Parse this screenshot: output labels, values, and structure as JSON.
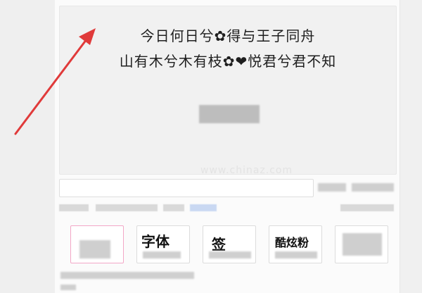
{
  "preview": {
    "line1": "今日何日兮✿得与王子同舟",
    "line2": "山有木兮木有枝✿❤悦君兮君不知",
    "watermark": "www.chinaz.com"
  },
  "input": {
    "placeholder": ""
  },
  "thumbnails": [
    {
      "label": ""
    },
    {
      "label": "字体"
    },
    {
      "label": "签"
    },
    {
      "label": "酷炫粉"
    },
    {
      "label": ""
    }
  ],
  "colors": {
    "annotation_arrow": "#e03a3a",
    "pink_border": "#f3a7c7"
  }
}
